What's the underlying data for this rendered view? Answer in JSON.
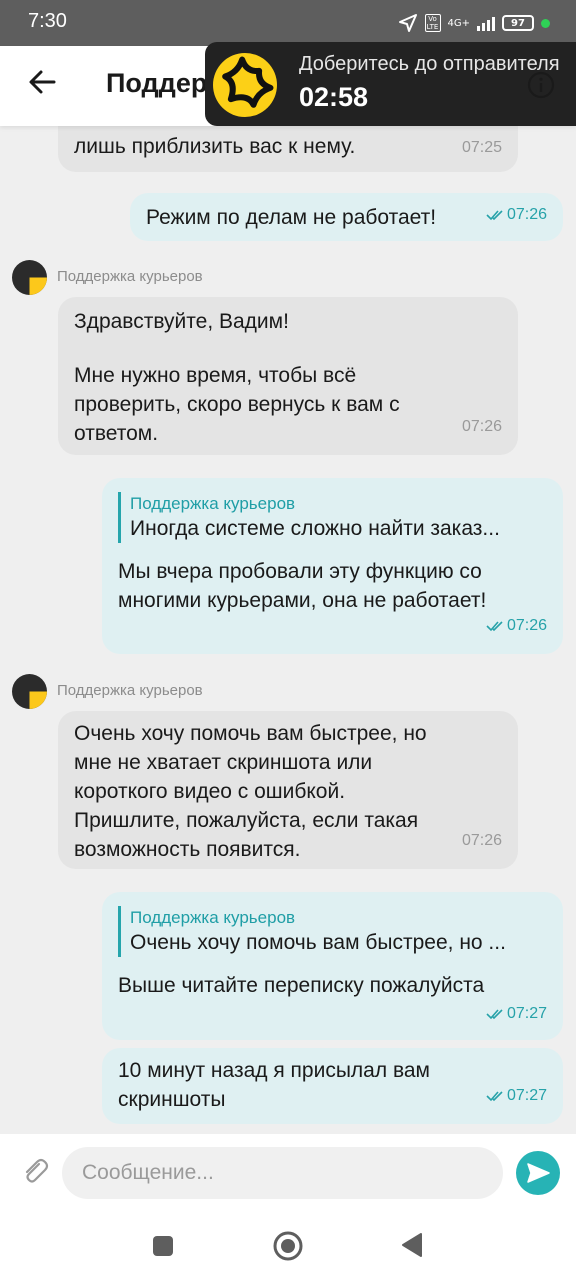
{
  "status_bar": {
    "time": "7:30",
    "network": "4G+",
    "volte": "Vo LTE",
    "battery": "97"
  },
  "header": {
    "title": "Поддержка курьеров"
  },
  "overlay": {
    "text": "Доберитесь до отправителя",
    "timer": "02:58"
  },
  "messages": [
    {
      "id": "m1",
      "type": "incoming",
      "lines": [
        "лишь приблизить вас к нему."
      ],
      "time": "07:25"
    },
    {
      "id": "m2",
      "type": "outgoing",
      "lines": [
        "Режим по делам не работает!"
      ],
      "time": "07:26",
      "read": true
    },
    {
      "id": "m3",
      "type": "incoming",
      "sender": "Поддержка курьеров",
      "lines": [
        "Здравствуйте, Вадим!",
        "",
        "Мне нужно время, чтобы всё",
        "проверить, скоро вернусь к вам с",
        "ответом."
      ],
      "time": "07:26"
    },
    {
      "id": "m4",
      "type": "outgoing",
      "quote": {
        "name": "Поддержка курьеров",
        "text": "Иногда системе сложно найти заказ..."
      },
      "lines": [
        "Мы вчера пробовали эту функцию со",
        "многими курьерами, она не работает!"
      ],
      "time": "07:26",
      "read": true
    },
    {
      "id": "m5",
      "type": "incoming",
      "sender": "Поддержка курьеров",
      "lines": [
        "Очень хочу помочь вам быстрее, но",
        "мне не хватает скриншота или",
        "короткого видео с ошибкой.",
        "Пришлите, пожалуйста, если такая",
        "возможность появится."
      ],
      "time": "07:26"
    },
    {
      "id": "m6",
      "type": "outgoing",
      "quote": {
        "name": "Поддержка курьеров",
        "text": "Очень хочу помочь вам быстрее, но ..."
      },
      "lines": [
        "Выше читайте переписку пожалуйста"
      ],
      "time": "07:27",
      "read": true
    },
    {
      "id": "m7",
      "type": "outgoing",
      "lines": [
        "10 минут назад я присылал вам",
        "скриншоты"
      ],
      "time": "07:27",
      "read": true
    }
  ],
  "input": {
    "placeholder": "Сообщение..."
  },
  "colors": {
    "accent": "#27b3b5",
    "outgoing_bubble": "#dff0f2",
    "incoming_bubble": "#e4e4e4",
    "brand_yellow": "#fcd017"
  },
  "icons": {
    "back": "arrow-left-icon",
    "info": "info-icon",
    "attach": "paperclip-icon",
    "send": "send-icon",
    "nav_recents": "square-icon",
    "nav_home": "circle-icon",
    "nav_back": "triangle-back-icon"
  }
}
